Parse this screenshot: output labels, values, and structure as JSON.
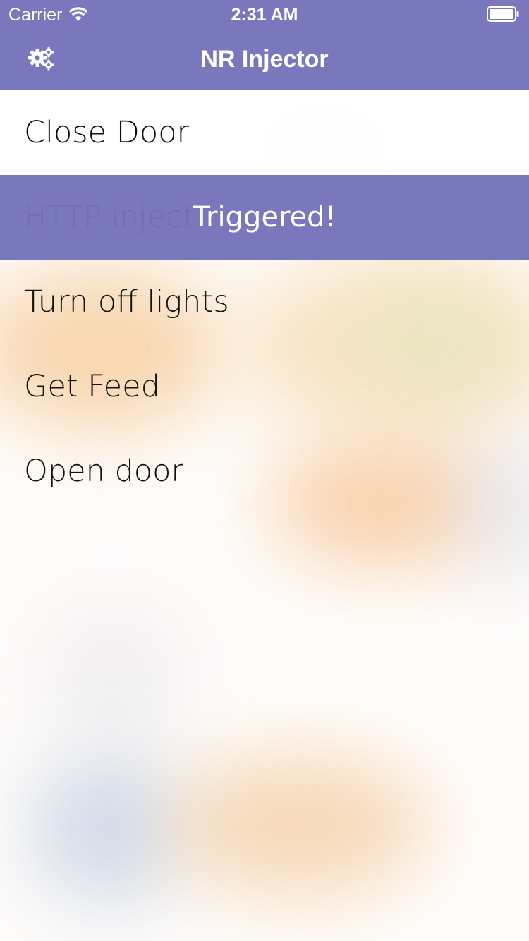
{
  "status_bar": {
    "carrier": "Carrier",
    "time": "2:31 AM",
    "wifi_icon": "wifi-icon",
    "battery_icon": "battery-icon"
  },
  "nav": {
    "title": "NR Injector",
    "settings_icon": "gears-icon"
  },
  "colors": {
    "accent": "#7a78bd",
    "text": "#111111",
    "on_accent": "#ffffff"
  },
  "list": {
    "items": [
      {
        "label": "Close Door"
      },
      {
        "label": "HTTP inject",
        "toast": "Triggered!"
      },
      {
        "label": "Turn off lights"
      },
      {
        "label": "Get Feed"
      },
      {
        "label": "Open door"
      }
    ]
  }
}
